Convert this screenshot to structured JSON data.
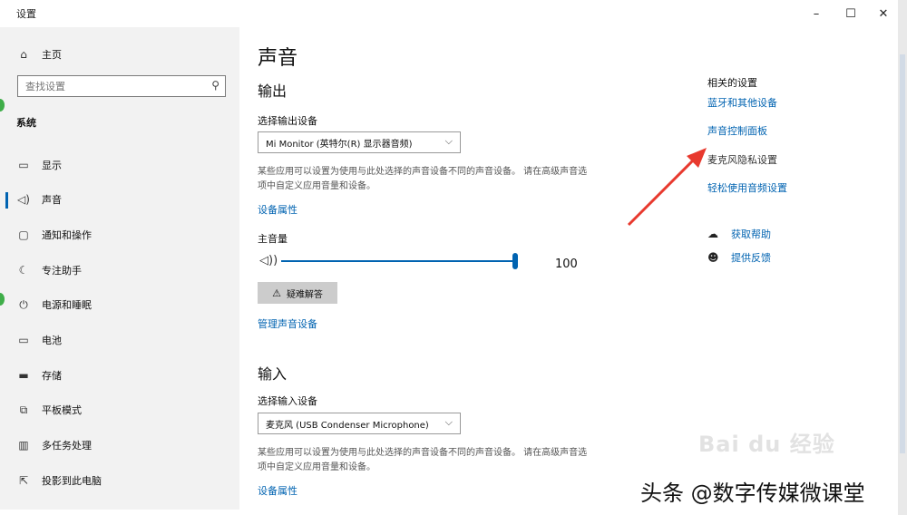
{
  "window": {
    "title": "设置",
    "minimize": "–",
    "maximize": "☐",
    "close": "✕"
  },
  "sidebar": {
    "home": {
      "label": "主页",
      "icon": "home-icon"
    },
    "search": {
      "placeholder": "查找设置"
    },
    "section": "系统",
    "items": [
      {
        "label": "显示",
        "icon": "monitor-icon"
      },
      {
        "label": "声音",
        "icon": "speaker-icon",
        "selected": true
      },
      {
        "label": "通知和操作",
        "icon": "notification-icon"
      },
      {
        "label": "专注助手",
        "icon": "moon-icon"
      },
      {
        "label": "电源和睡眠",
        "icon": "power-icon"
      },
      {
        "label": "电池",
        "icon": "battery-icon"
      },
      {
        "label": "存储",
        "icon": "storage-icon"
      },
      {
        "label": "平板模式",
        "icon": "tablet-icon"
      },
      {
        "label": "多任务处理",
        "icon": "multitask-icon"
      },
      {
        "label": "投影到此电脑",
        "icon": "project-icon"
      }
    ]
  },
  "main": {
    "title": "声音",
    "output": {
      "heading": "输出",
      "device_label": "选择输出设备",
      "device_value": "Mi Monitor (英特尔(R) 显示器音频)",
      "description": "某些应用可以设置为使用与此处选择的声音设备不同的声音设备。 请在高级声音选项中自定义应用音量和设备。",
      "device_properties": "设备属性",
      "volume_label": "主音量",
      "volume": 100,
      "troubleshoot": "疑难解答",
      "manage_devices": "管理声音设备"
    },
    "input": {
      "heading": "输入",
      "device_label": "选择输入设备",
      "device_value": "麦克风 (USB Condenser Microphone)",
      "description": "某些应用可以设置为使用与此处选择的声音设备不同的声音设备。 请在高级声音选项中自定义应用音量和设备。",
      "device_properties": "设备属性"
    }
  },
  "related": {
    "title": "相关的设置",
    "links": [
      "蓝牙和其他设备",
      "声音控制面板"
    ],
    "inactive": "麦克风隐私设置",
    "ease_link": "轻松使用音频设置",
    "help": [
      {
        "label": "获取帮助",
        "icon": "help-chat-icon"
      },
      {
        "label": "提供反馈",
        "icon": "feedback-icon"
      }
    ]
  },
  "overlay": {
    "watermark": "Bai du 经验",
    "caption": "头条 @数字传媒微课堂"
  },
  "colors": {
    "accent": "#0063b1",
    "annotation_arrow": "#e8392e",
    "sidebar_bg": "#f2f2f2"
  }
}
